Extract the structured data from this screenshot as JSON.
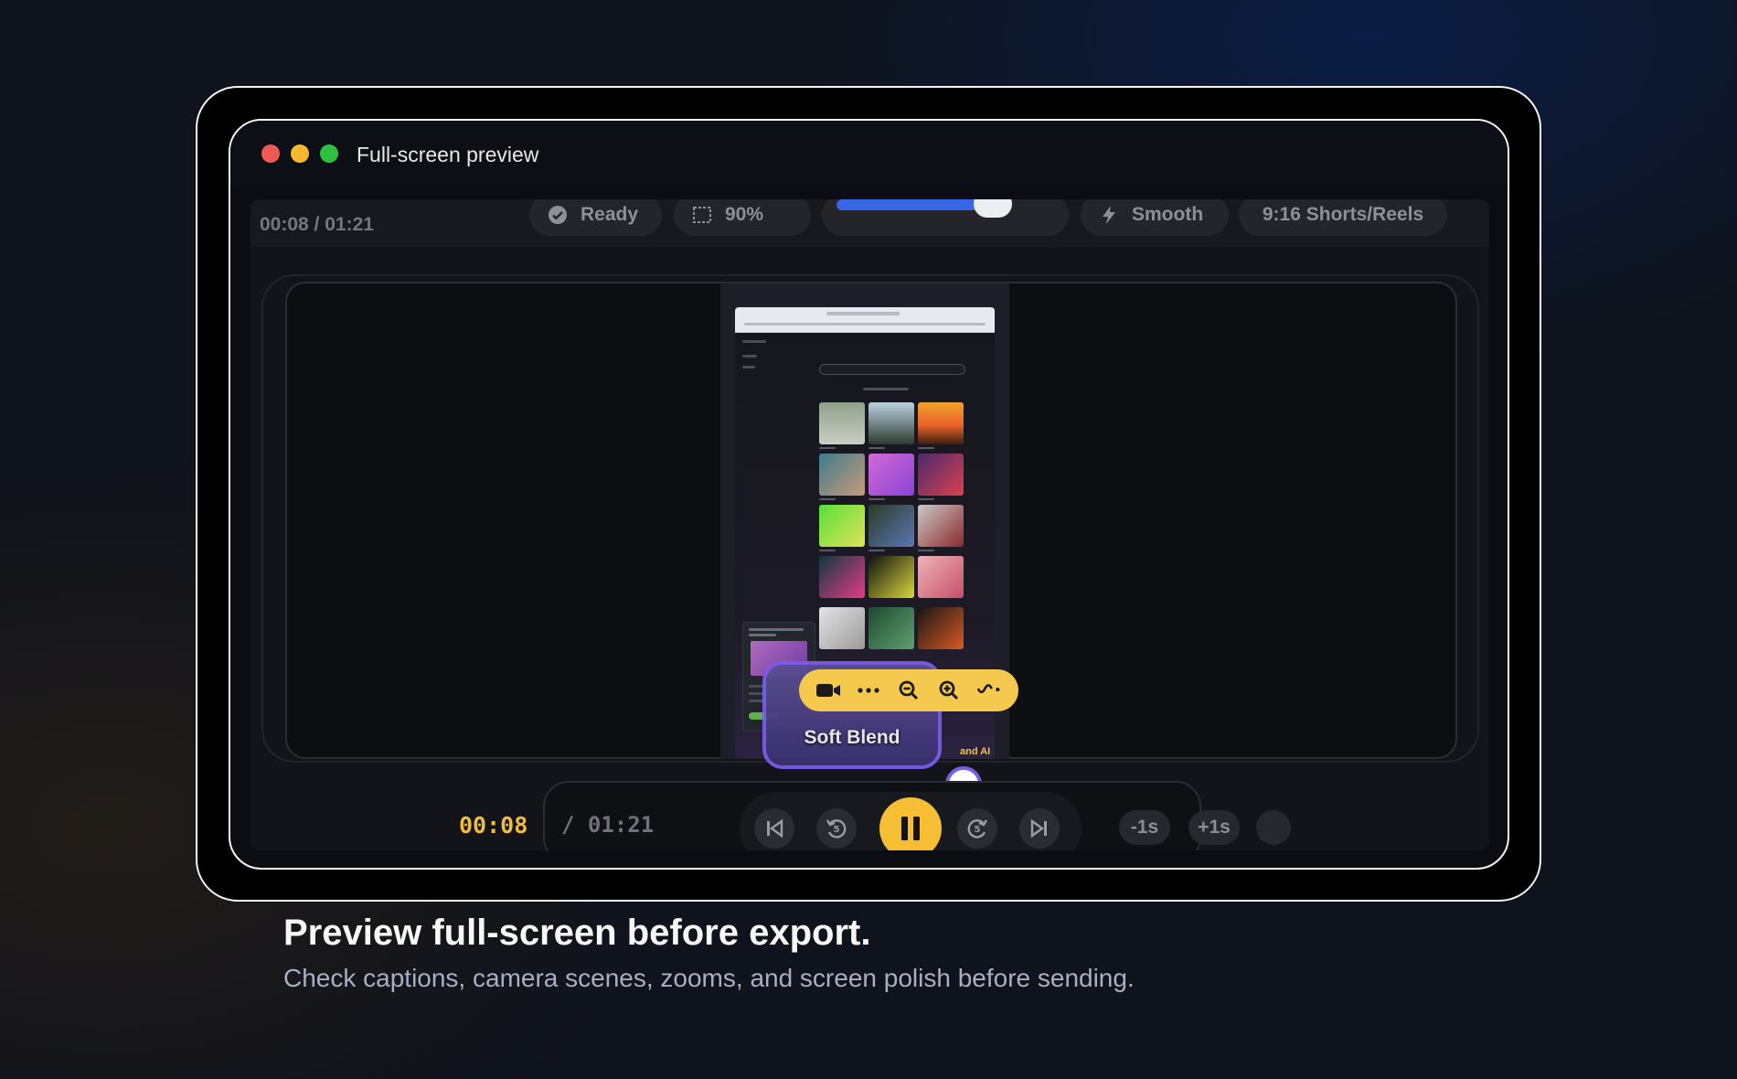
{
  "window": {
    "title": "Full-screen preview"
  },
  "toolbar": {
    "timecode": "00:08 / 01:21",
    "status_label": "Ready",
    "zoom_label": "90%",
    "slider_fraction": 0.72,
    "motion_label": "Smooth",
    "aspect_label": "9:16 Shorts/Reels"
  },
  "preview": {
    "camera_caption": "Soft Blend",
    "brand_tag": "and AI"
  },
  "transport": {
    "current_time": "00:08",
    "total_time": "/ 01:21",
    "nudge_back_label": "-1s",
    "nudge_forward_label": "+1s"
  },
  "caption": {
    "title": "Preview full-screen before export.",
    "subtitle": "Check captions, camera scenes, zooms, and screen polish before sending."
  },
  "colors": {
    "accent_yellow": "#f5be33",
    "accent_blue": "#3767e8",
    "camera_purple": "#7b5ce6"
  }
}
